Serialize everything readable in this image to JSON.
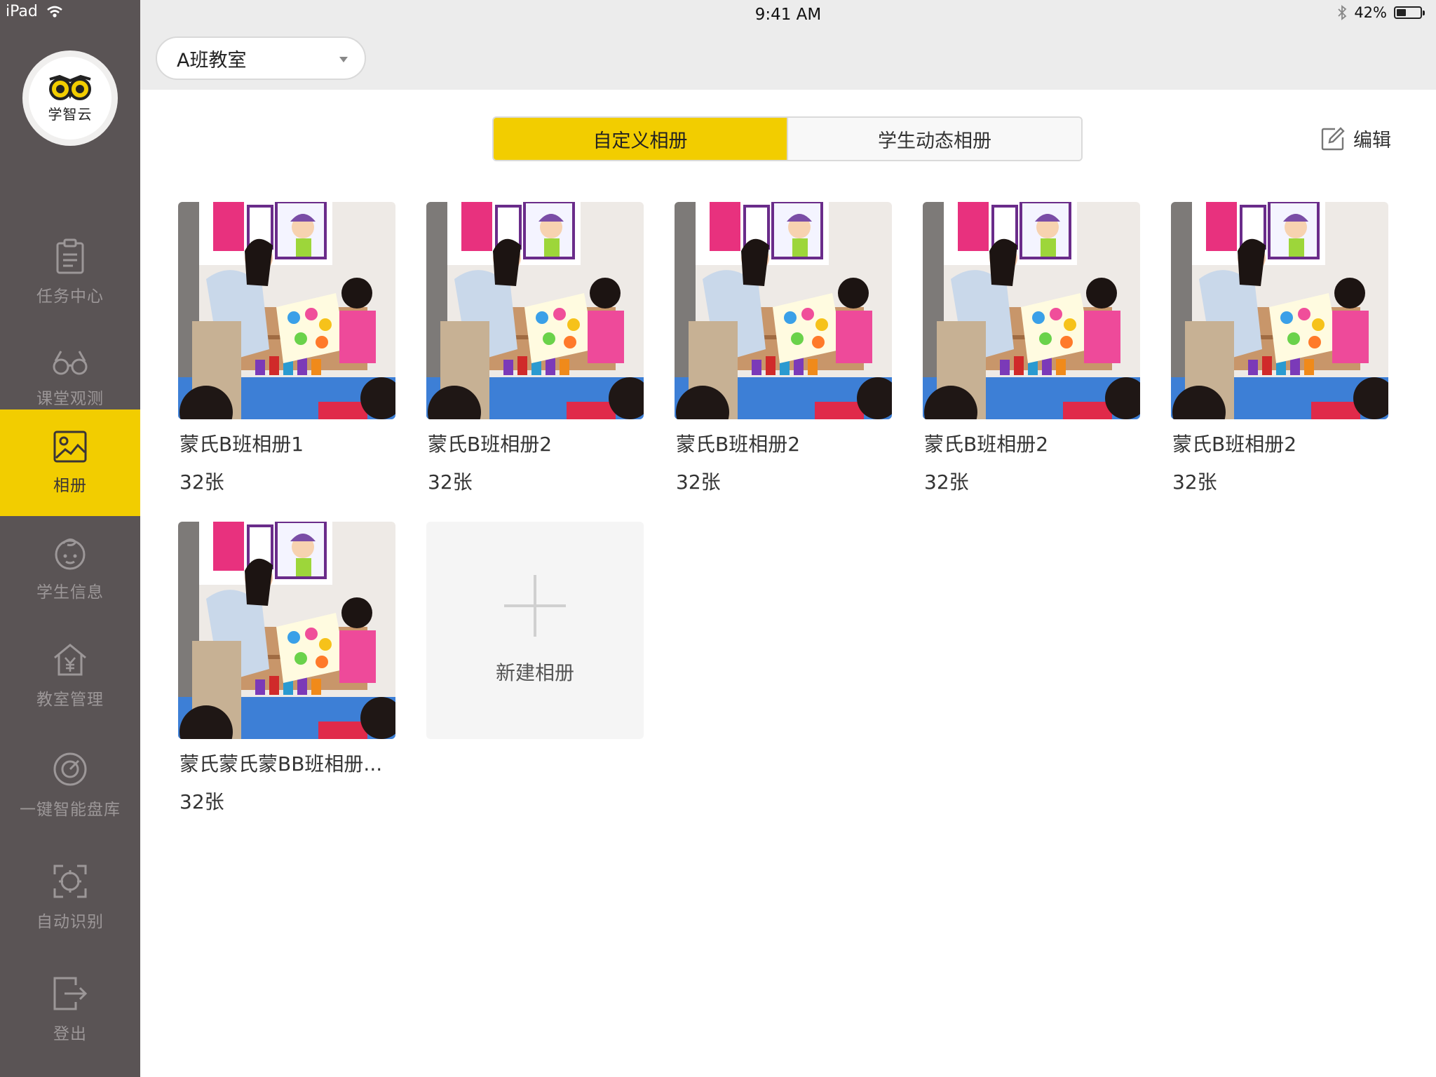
{
  "status_bar": {
    "device": "iPad",
    "time": "9:41 AM",
    "battery_percent_label": "42%",
    "battery_level": 0.42
  },
  "sidebar": {
    "logo_text": "学智云",
    "items": [
      {
        "label": "任务中心",
        "icon": "clipboard-icon",
        "active": false
      },
      {
        "label": "课堂观测",
        "icon": "glasses-icon",
        "active": false
      },
      {
        "label": "相册",
        "icon": "image-icon",
        "active": true
      },
      {
        "label": "学生信息",
        "icon": "baby-face-icon",
        "active": false
      },
      {
        "label": "教室管理",
        "icon": "house-yen-icon",
        "active": false
      },
      {
        "label": "一键智能盘库",
        "icon": "gauge-icon",
        "active": false
      },
      {
        "label": "自动识别",
        "icon": "scan-target-icon",
        "active": false
      },
      {
        "label": "登出",
        "icon": "logout-icon",
        "active": false
      }
    ]
  },
  "header": {
    "class_select": "A班教室"
  },
  "tabs": [
    {
      "label": "自定义相册",
      "active": true
    },
    {
      "label": "学生动态相册",
      "active": false
    }
  ],
  "edit_label": "编辑",
  "albums": [
    {
      "name": "蒙氏B班相册1",
      "count": "32张"
    },
    {
      "name": "蒙氏B班相册2",
      "count": "32张"
    },
    {
      "name": "蒙氏B班相册2",
      "count": "32张"
    },
    {
      "name": "蒙氏B班相册2",
      "count": "32张"
    },
    {
      "name": "蒙氏B班相册2",
      "count": "32张"
    },
    {
      "name": "蒙氏蒙氏蒙BB班相册...",
      "count": "32张"
    }
  ],
  "new_album_label": "新建相册",
  "colors": {
    "accent": "#f2cd00",
    "sidebar_bg": "#5a5455",
    "header_bg": "#ececec"
  }
}
